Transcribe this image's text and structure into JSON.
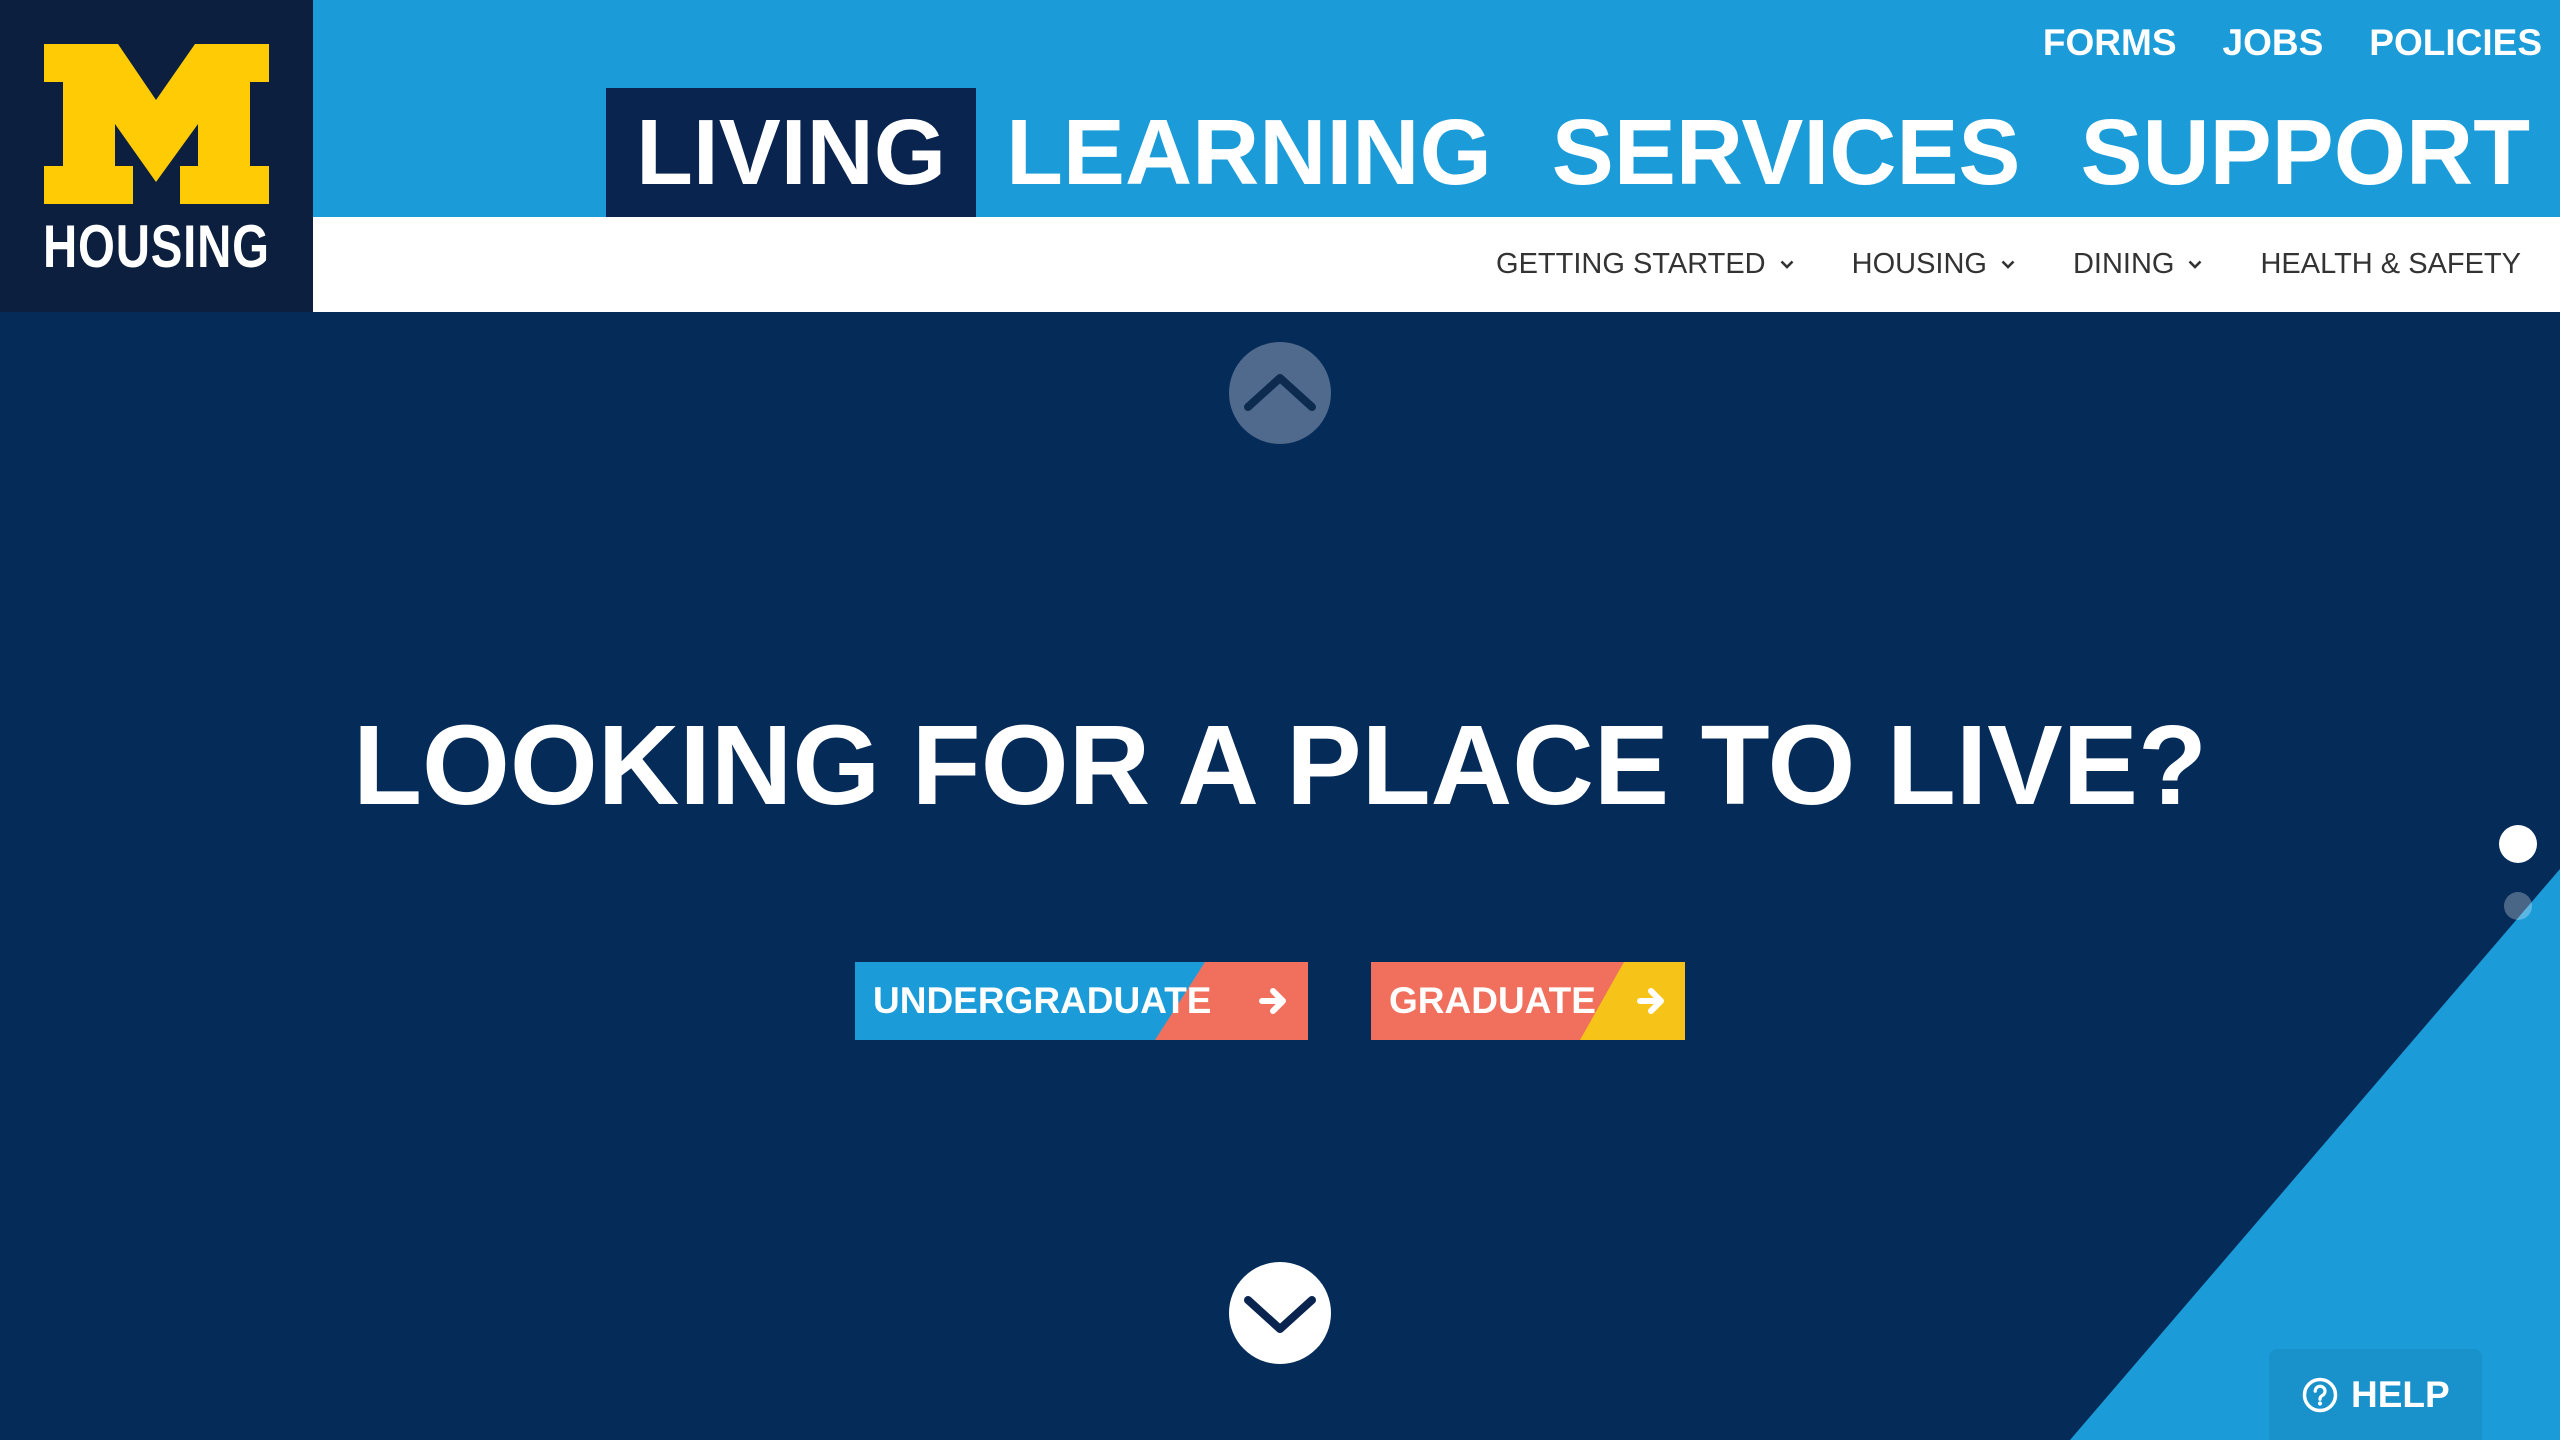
{
  "brand": {
    "logo_letter": "M",
    "logo_text": "HOUSING"
  },
  "utility_nav": [
    {
      "label": "FORMS"
    },
    {
      "label": "JOBS"
    },
    {
      "label": "POLICIES"
    }
  ],
  "main_nav": [
    {
      "label": "LIVING",
      "active": true
    },
    {
      "label": "LEARNING",
      "active": false
    },
    {
      "label": "SERVICES",
      "active": false
    },
    {
      "label": "SUPPORT",
      "active": false
    }
  ],
  "sub_nav": [
    {
      "label": "GETTING STARTED",
      "has_dropdown": true,
      "icon": "chevron-down-icon"
    },
    {
      "label": "HOUSING",
      "has_dropdown": true,
      "icon": "chevron-down-icon"
    },
    {
      "label": "DINING",
      "has_dropdown": true,
      "icon": "chevron-down-icon"
    },
    {
      "label": "HEALTH & SAFETY",
      "has_dropdown": false
    }
  ],
  "hero": {
    "scroll_up_icon": "chevron-up-icon",
    "headline": "LOOKING FOR A PLACE TO LIVE?",
    "buttons": [
      {
        "label": "UNDERGRADUATE",
        "icon": "arrow-right-icon"
      },
      {
        "label": "GRADUATE",
        "icon": "arrow-right-icon"
      }
    ],
    "scroll_down_icon": "chevron-down-icon"
  },
  "carousel": {
    "slide_count": 2,
    "active_slide": 1
  },
  "help": {
    "label": "HELP",
    "icon": "question-circle-icon"
  },
  "colors": {
    "brand_blue": "#1b9cd8",
    "hero_navy": "#052b59",
    "logo_navy": "#0c1f3e",
    "active_nav": "#0a2450",
    "maize": "#ffcb05",
    "coral": "#f0705d",
    "yellow": "#f6c418",
    "help_bg": "#1991cb",
    "subnav_text": "#333333"
  }
}
